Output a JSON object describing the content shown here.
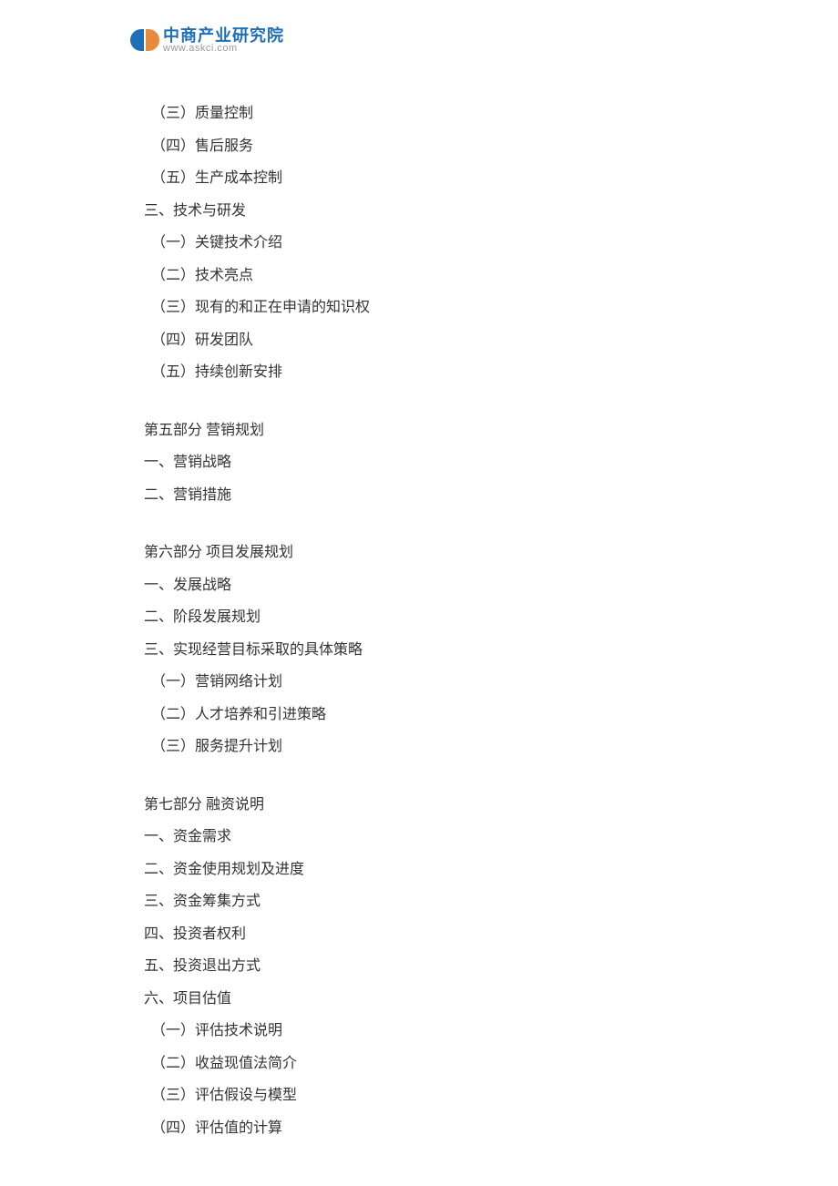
{
  "header": {
    "logo_title": "中商产业研究院",
    "logo_url": "www.askci.com"
  },
  "toc": {
    "block1": [
      "（三）质量控制",
      "（四）售后服务",
      "（五）生产成本控制",
      "三、技术与研发",
      "（一）关键技术介绍",
      "（二）技术亮点",
      "（三）现有的和正在申请的知识权",
      "（四）研发团队",
      "（五）持续创新安排"
    ],
    "block2": [
      "第五部分  营销规划",
      "一、营销战略",
      "二、营销措施"
    ],
    "block3": [
      "第六部分  项目发展规划",
      "一、发展战略",
      "二、阶段发展规划",
      "三、实现经营目标采取的具体策略",
      "（一）营销网络计划",
      "（二）人才培养和引进策略",
      "（三）服务提升计划"
    ],
    "block4": [
      "第七部分  融资说明",
      "一、资金需求",
      "二、资金使用规划及进度",
      "三、资金筹集方式",
      "四、投资者权利",
      "五、投资退出方式",
      "六、项目估值",
      "（一）评估技术说明",
      "（二）收益现值法简介",
      "（三）评估假设与模型",
      "（四）评估值的计算"
    ]
  }
}
